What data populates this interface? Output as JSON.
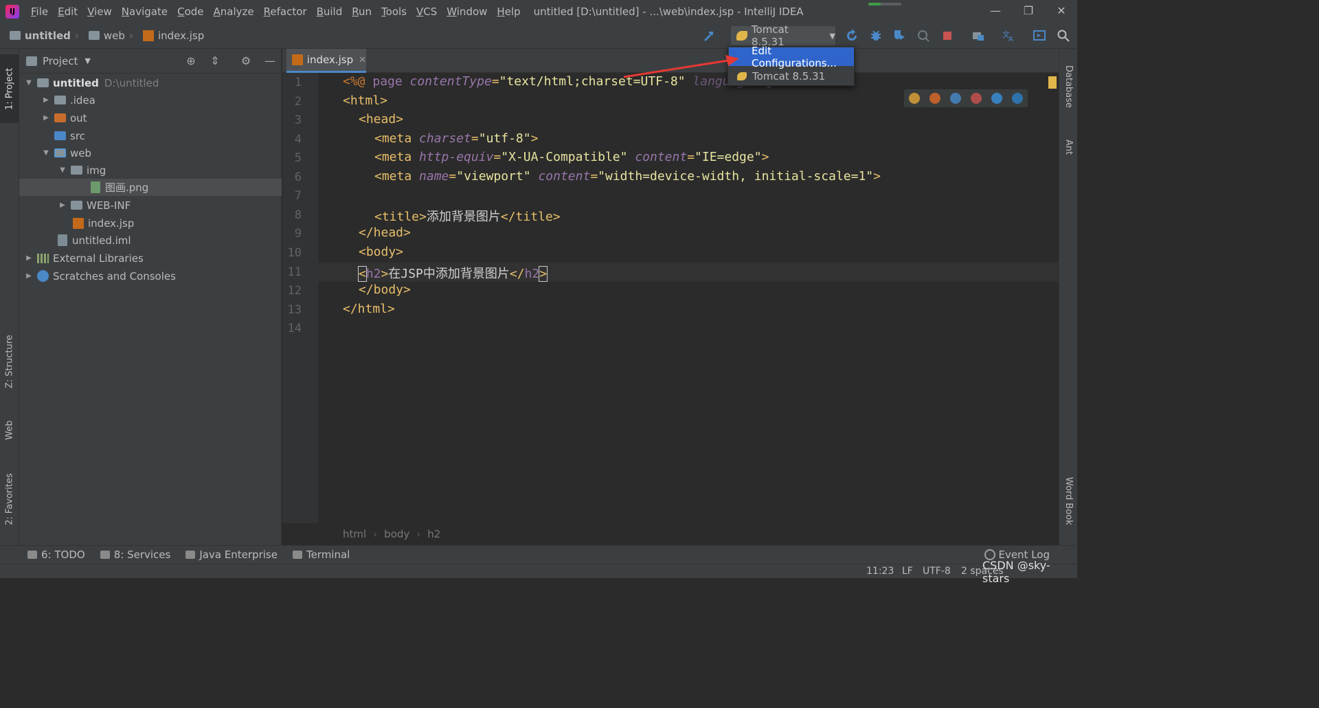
{
  "app": {
    "title": "untitled [D:\\untitled] - ...\\web\\index.jsp - IntelliJ IDEA",
    "logo_text": "IJ",
    "menu": [
      "File",
      "Edit",
      "View",
      "Navigate",
      "Code",
      "Analyze",
      "Refactor",
      "Build",
      "Run",
      "Tools",
      "VCS",
      "Window",
      "Help"
    ],
    "window_controls": {
      "minimize": "—",
      "restore": "❐",
      "close": "✕"
    }
  },
  "navbar": {
    "crumbs": [
      "untitled",
      "web",
      "index.jsp"
    ],
    "run_config": "Tomcat 8.5.31"
  },
  "popup": {
    "items": [
      "Edit Configurations...",
      "Tomcat 8.5.31"
    ]
  },
  "left_strip": {
    "project": "1: Project",
    "structure": "Z: Structure",
    "web": "Web",
    "favorites": "2: Favorites"
  },
  "right_strip": {
    "database": "Database",
    "ant": "Ant",
    "wordbook": "Word Book"
  },
  "project_panel": {
    "title": "Project",
    "tree": [
      {
        "label": "untitled",
        "extra": "D:\\untitled"
      },
      {
        "label": ".idea"
      },
      {
        "label": "out"
      },
      {
        "label": "src"
      },
      {
        "label": "web"
      },
      {
        "label": "img"
      },
      {
        "label": "图画.png"
      },
      {
        "label": "WEB-INF"
      },
      {
        "label": "index.jsp"
      },
      {
        "label": "untitled.iml"
      },
      {
        "label": "External Libraries"
      },
      {
        "label": "Scratches and Consoles"
      }
    ]
  },
  "editor": {
    "tab": "index.jsp",
    "line_numbers": [
      "1",
      "2",
      "3",
      "4",
      "5",
      "6",
      "7",
      "8",
      "9",
      "10",
      "11",
      "12",
      "13",
      "14"
    ],
    "code": {
      "l1": {
        "open": "<%@",
        "kw": " page ",
        "attr": "contentType",
        "eq": "=",
        "val": "\"text/html;charset=UTF-8\"",
        "rest": " language=\"java\" %>"
      },
      "l2": "<html>",
      "l3": "<head>",
      "l4": {
        "open": "<meta ",
        "attr": "charset",
        "eq": "=",
        "val": "\"utf-8\"",
        "close": ">"
      },
      "l5": {
        "open": "<meta ",
        "attr1": "http-equiv",
        "eq1": "=",
        "val1": "\"X-UA-Compatible\"",
        "sp": " ",
        "attr2": "content",
        "eq2": "=",
        "val2": "\"IE=edge\"",
        "close": ">"
      },
      "l6": {
        "open": "<meta ",
        "attr1": "name",
        "eq1": "=",
        "val1": "\"viewport\"",
        "sp": " ",
        "attr2": "content",
        "eq2": "=",
        "val2": "\"width=device-width, initial-scale=1\"",
        "close": ">"
      },
      "l8": {
        "open": "<title>",
        "text": "添加背景图片",
        "close": "</title>"
      },
      "l9": "</head>",
      "l10": "<body>",
      "l11": {
        "lt": "<",
        "tag": "h2",
        "gt": ">",
        "text": "在JSP中添加背景图片",
        "lt2": "</",
        "tag2": "h2",
        "gt2": ">"
      },
      "l12": "</body>",
      "l13": "</html>"
    },
    "breadcrumb": [
      "html",
      "body",
      "h2"
    ]
  },
  "bottom_tools": [
    "6: TODO",
    "8: Services",
    "Java Enterprise",
    "Terminal"
  ],
  "event_log": "Event Log",
  "status": {
    "position": "11:23",
    "line_sep": "LF",
    "encoding": "UTF-8",
    "indent": "2 spaces"
  },
  "watermark": "CSDN @sky-stars",
  "colors": {
    "accent": "#2f65ca",
    "arrow": "#e53935",
    "tag": "#e8bf6a",
    "attr": "#9876aa",
    "string": "#e8e4a0"
  }
}
